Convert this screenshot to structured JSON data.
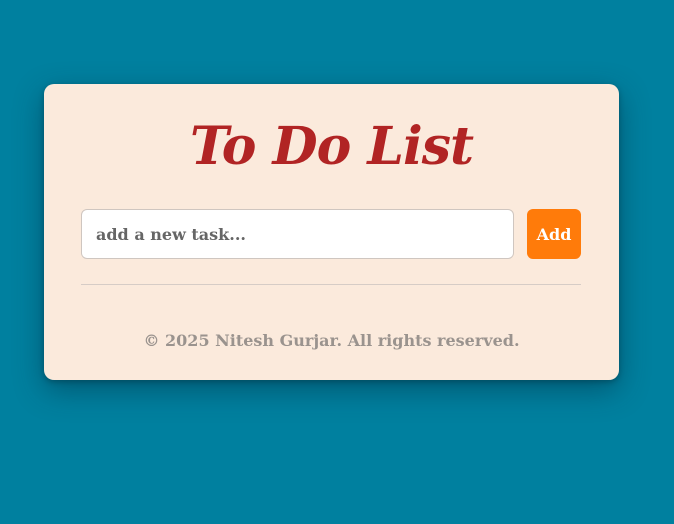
{
  "app": {
    "title": "To Do List"
  },
  "input": {
    "placeholder": "add a new task...",
    "value": ""
  },
  "add_button": {
    "label": "Add"
  },
  "tasks": [],
  "footer": {
    "text": "© 2025 Nitesh Gurjar. All rights reserved."
  },
  "colors": {
    "background": "#00809f",
    "card": "#fbeadc",
    "title": "#b12424",
    "button": "#ff7b0a",
    "footer_text": "#9a938e"
  }
}
